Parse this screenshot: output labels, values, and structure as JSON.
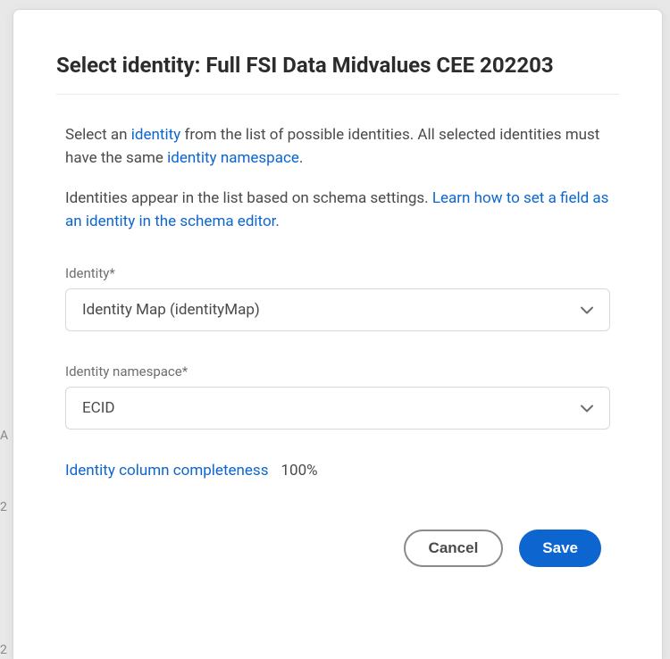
{
  "dialog": {
    "title": "Select identity: Full FSI Data Midvalues CEE 202203",
    "intro1_pre": "Select an ",
    "intro1_link1": "identity",
    "intro1_mid": " from the list of possible identities. All selected identities must have the same ",
    "intro1_link2": "identity namespace",
    "intro1_post": ".",
    "intro2_pre": "Identities appear in the list based on schema settings. ",
    "intro2_link": "Learn how to set a field as an identity in the schema editor."
  },
  "fields": {
    "identity": {
      "label": "Identity*",
      "value": "Identity Map (identityMap)"
    },
    "namespace": {
      "label": "Identity namespace*",
      "value": "ECID"
    }
  },
  "completeness": {
    "label": "Identity column completeness",
    "value": "100%"
  },
  "buttons": {
    "cancel": "Cancel",
    "save": "Save"
  },
  "backdrop": {
    "a": "A",
    "b": "2",
    "c": "2"
  }
}
